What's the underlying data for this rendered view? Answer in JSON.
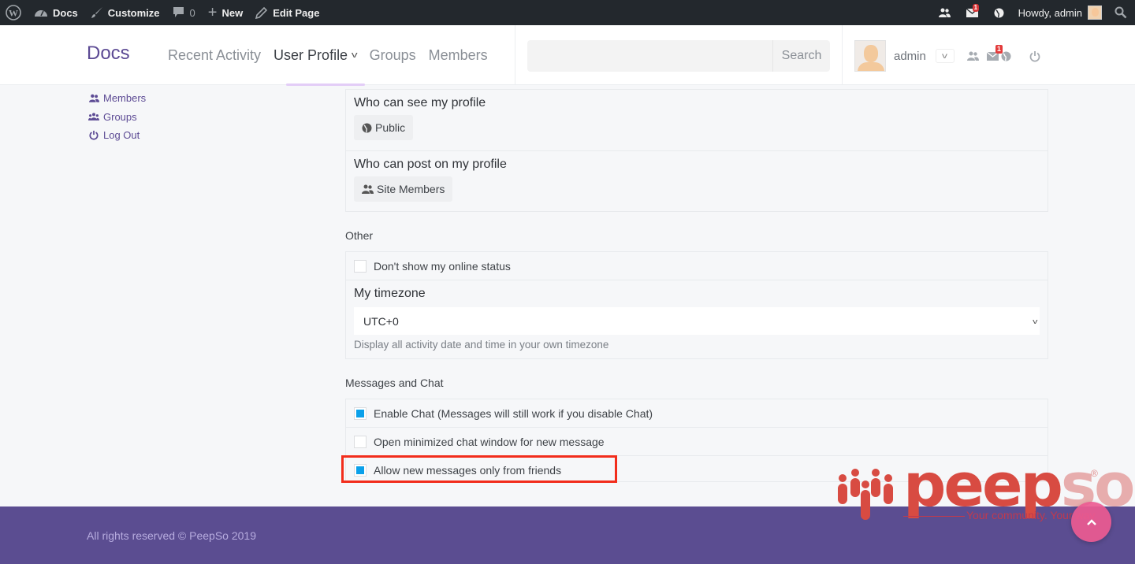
{
  "admin_bar": {
    "site_name": "Docs",
    "customize": "Customize",
    "comments_count": "0",
    "new": "New",
    "edit_page": "Edit Page",
    "messages_badge": "1",
    "howdy": "Howdy, admin"
  },
  "header": {
    "brand": "Docs",
    "nav": [
      {
        "label": "Recent Activity",
        "active": false
      },
      {
        "label": "User Profile",
        "active": true
      },
      {
        "label": "Groups",
        "active": false
      },
      {
        "label": "Members",
        "active": false
      }
    ],
    "search": {
      "placeholder": "",
      "value": "",
      "button": "Search"
    },
    "user": {
      "name": "admin",
      "messages_badge": "1"
    }
  },
  "sidebar": {
    "links": [
      {
        "label": "Members",
        "icon": "members-icon"
      },
      {
        "label": "Groups",
        "icon": "groups-icon"
      },
      {
        "label": "Log Out",
        "icon": "power-icon"
      }
    ]
  },
  "privacy": {
    "see_profile": {
      "title": "Who can see my profile",
      "value": "Public",
      "icon": "globe-icon"
    },
    "post_profile": {
      "title": "Who can post on my profile",
      "value": "Site Members",
      "icon": "members-icon"
    }
  },
  "other": {
    "label": "Other",
    "online_status": {
      "label": "Don't show my online status",
      "checked": false
    },
    "timezone": {
      "title": "My timezone",
      "value": "UTC+0",
      "help": "Display all activity date and time in your own timezone"
    }
  },
  "messages": {
    "label": "Messages and Chat",
    "options": [
      {
        "label": "Enable Chat (Messages will still work if you disable Chat)",
        "checked": true
      },
      {
        "label": "Open minimized chat window for new message",
        "checked": false
      },
      {
        "label": "Allow new messages only from friends",
        "checked": true
      }
    ]
  },
  "footer": {
    "copyright": "All rights reserved © PeepSo 2019"
  },
  "watermark": {
    "peep": "peep",
    "so": "so",
    "reg": "®",
    "tagline": "Your community. Your way."
  },
  "colors": {
    "brand": "#5c4a94",
    "footer": "#5b4d91",
    "checkbox_fill": "#0aa0ea",
    "highlight": "#f22d1c",
    "to_top": "#ec5a91"
  }
}
